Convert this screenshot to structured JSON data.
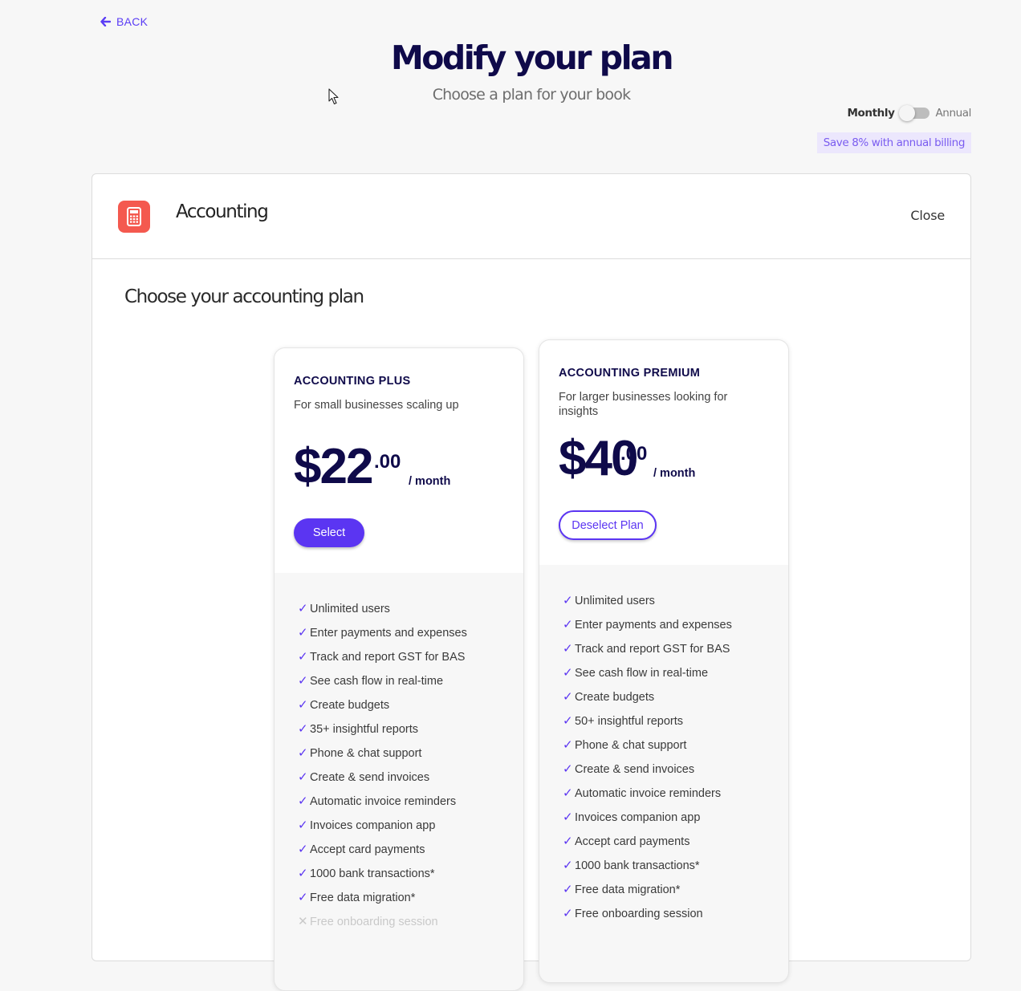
{
  "header": {
    "back_label": "BACK",
    "title": "Modify your plan",
    "subtitle": "Choose a plan for your book"
  },
  "billing": {
    "monthly_label": "Monthly",
    "annual_label": "Annual",
    "annual_selected": false,
    "save_badge": "Save 8% with annual billing"
  },
  "panel": {
    "title": "Accounting",
    "close_label": "Close",
    "icon": "calculator-icon",
    "icon_color": "#f4594f",
    "section_title": "Choose your accounting plan"
  },
  "colors": {
    "accent": "#5b35f2",
    "heading": "#0f0a4a"
  },
  "plans": [
    {
      "name": "ACCOUNTING PLUS",
      "description": "For small businesses scaling up",
      "price_dollars": "$22",
      "price_cents": ".00",
      "period": "/ month",
      "button_label": "Select",
      "selected": false,
      "features": [
        {
          "label": "Unlimited users",
          "included": true
        },
        {
          "label": "Enter payments and expenses",
          "included": true
        },
        {
          "label": "Track and report GST for BAS",
          "included": true
        },
        {
          "label": "See cash flow in real-time",
          "included": true
        },
        {
          "label": "Create budgets",
          "included": true
        },
        {
          "label": "35+ insightful reports",
          "included": true
        },
        {
          "label": "Phone & chat support",
          "included": true
        },
        {
          "label": "Create & send invoices",
          "included": true
        },
        {
          "label": "Automatic invoice reminders",
          "included": true
        },
        {
          "label": "Invoices companion app",
          "included": true
        },
        {
          "label": "Accept card payments",
          "included": true
        },
        {
          "label": "1000 bank transactions*",
          "included": true
        },
        {
          "label": "Free data migration*",
          "included": true
        },
        {
          "label": "Free onboarding session",
          "included": false
        }
      ]
    },
    {
      "name": "ACCOUNTING PREMIUM",
      "description": "For larger businesses looking for insights",
      "price_dollars": "$40",
      "price_cents": ".00",
      "period": "/ month",
      "button_label": "Deselect Plan",
      "selected": true,
      "features": [
        {
          "label": "Unlimited users",
          "included": true
        },
        {
          "label": "Enter payments and expenses",
          "included": true
        },
        {
          "label": "Track and report GST for BAS",
          "included": true
        },
        {
          "label": "See cash flow in real-time",
          "included": true
        },
        {
          "label": "Create budgets",
          "included": true
        },
        {
          "label": "50+ insightful reports",
          "included": true
        },
        {
          "label": "Phone & chat support",
          "included": true
        },
        {
          "label": "Create & send invoices",
          "included": true
        },
        {
          "label": "Automatic invoice reminders",
          "included": true
        },
        {
          "label": "Invoices companion app",
          "included": true
        },
        {
          "label": "Accept card payments",
          "included": true
        },
        {
          "label": "1000 bank transactions*",
          "included": true
        },
        {
          "label": "Free data migration*",
          "included": true
        },
        {
          "label": "Free onboarding session",
          "included": true
        }
      ]
    }
  ]
}
